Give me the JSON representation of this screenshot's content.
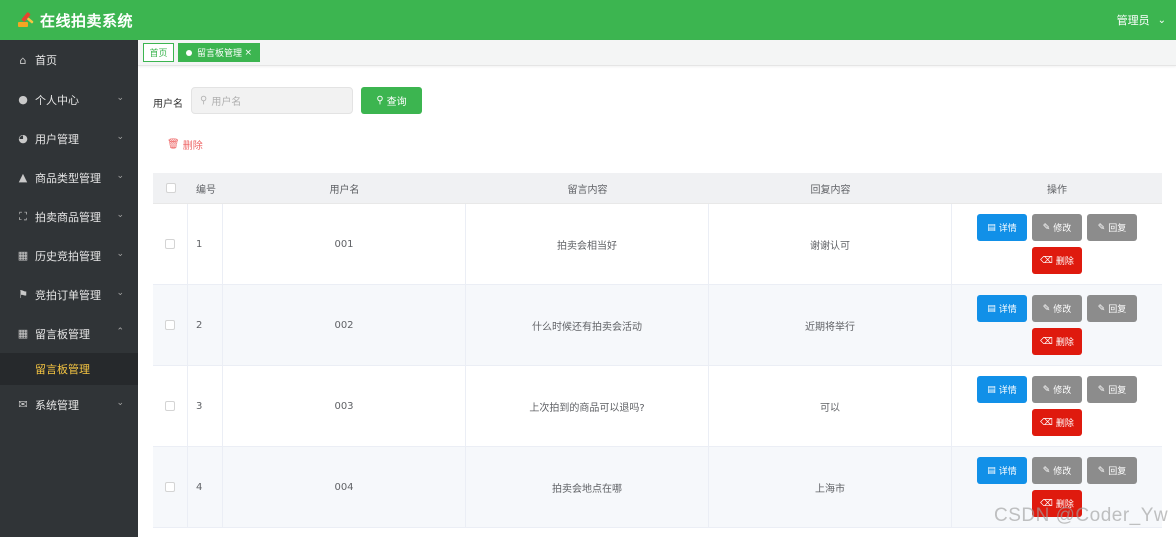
{
  "header": {
    "app_title": "在线拍卖系统",
    "user_label": "管理员",
    "logo_icon": "gavel-icon",
    "brand_color": "#3cb550"
  },
  "sidebar": {
    "items": [
      {
        "label": "首页",
        "icon": "home-icon"
      },
      {
        "label": "个人中心",
        "icon": "user-icon"
      },
      {
        "label": "用户管理",
        "icon": "dashboard-icon"
      },
      {
        "label": "商品类型管理",
        "icon": "stamp-icon"
      },
      {
        "label": "拍卖商品管理",
        "icon": "fullscreen-icon"
      },
      {
        "label": "历史竞拍管理",
        "icon": "document-icon"
      },
      {
        "label": "竞拍订单管理",
        "icon": "flag-icon"
      },
      {
        "label": "留言板管理",
        "icon": "grid-icon"
      },
      {
        "label": "系统管理",
        "icon": "mail-icon"
      }
    ],
    "submenu": {
      "label": "留言板管理"
    }
  },
  "tags": {
    "home": "首页",
    "active": "留言板管理"
  },
  "search": {
    "label": "用户名",
    "placeholder": "用户名",
    "button": "查询"
  },
  "actions": {
    "delete_label": "删除"
  },
  "table": {
    "headers": {
      "id": "编号",
      "username": "用户名",
      "message": "留言内容",
      "reply": "回复内容",
      "operation": "操作"
    },
    "rows": [
      {
        "id": "1",
        "username": "001",
        "message": "拍卖会相当好",
        "reply": "谢谢认可"
      },
      {
        "id": "2",
        "username": "002",
        "message": "什么时候还有拍卖会活动",
        "reply": "近期将举行"
      },
      {
        "id": "3",
        "username": "003",
        "message": "上次拍到的商品可以退吗?",
        "reply": "可以"
      },
      {
        "id": "4",
        "username": "004",
        "message": "拍卖会地点在哪",
        "reply": "上海市"
      }
    ],
    "row_buttons": {
      "detail": "详情",
      "edit": "修改",
      "reply": "回复",
      "delete": "删除"
    }
  },
  "watermark": "CSDN @Coder_Yw"
}
